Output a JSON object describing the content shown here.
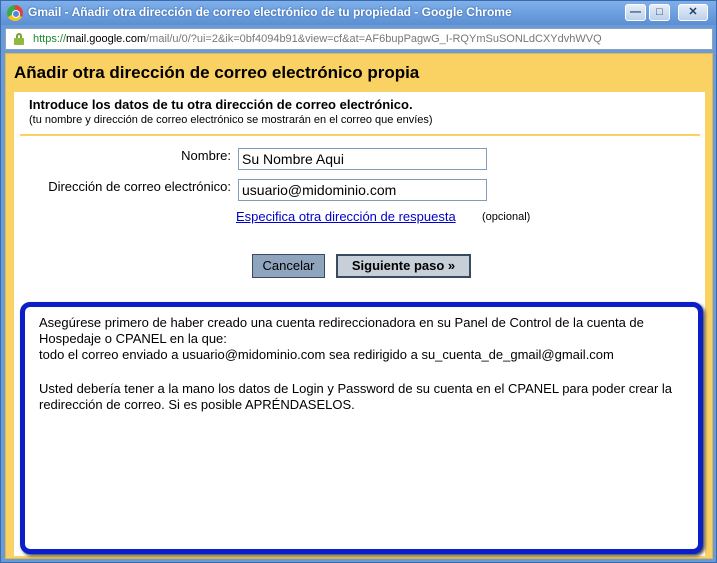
{
  "window": {
    "title": "Gmail - Añadir otra dirección de correo electrónico de tu propiedad - Google Chrome",
    "min_glyph": "—",
    "max_glyph": "□",
    "close_glyph": "✕"
  },
  "address_bar": {
    "scheme": "https://",
    "host": "mail.google.com",
    "path": "/mail/u/0/?ui=2&ik=0bf4094b91&view=cf&at=AF6bupPagwG_I-RQYmSuSONLdCXYdvhWVQ"
  },
  "dialog": {
    "title": "Añadir otra dirección de correo electrónico propia",
    "intro_title": "Introduce los datos de tu otra dirección de correo electrónico.",
    "intro_subtitle": "(tu nombre y dirección de correo electrónico se mostrarán en el correo que envíes)",
    "name_label": "Nombre:",
    "name_value": "Su Nombre Aqui",
    "email_label": "Dirección de correo electrónico:",
    "email_value": "usuario@midominio.com",
    "reply_link": "Especifica otra dirección de respuesta",
    "optional_text": "(opcional)",
    "cancel_label": "Cancelar",
    "next_label": "Siguiente paso »"
  },
  "note": {
    "paragraph_1_line_1": "Asegúrese primero de haber creado una cuenta redireccionadora en su Panel de Control de la cuenta de Hospedaje o CPANEL en la que:",
    "paragraph_1_line_2": "todo el correo enviado a usuario@midominio.com sea redirigido a su_cuenta_de_gmail@gmail.com",
    "paragraph_2": "Usted  debería tener a la mano los datos de Login y Password de su cuenta en el CPANEL para poder crear  la redirección de correo. Si es posible APRÉNDASELOS."
  },
  "colors": {
    "header_background": "#fad163",
    "note_border": "#0a1fc8",
    "link": "#0000cc"
  },
  "icons": [
    "chrome-icon",
    "minimize-icon",
    "maximize-icon",
    "close-icon",
    "lock-icon"
  ]
}
